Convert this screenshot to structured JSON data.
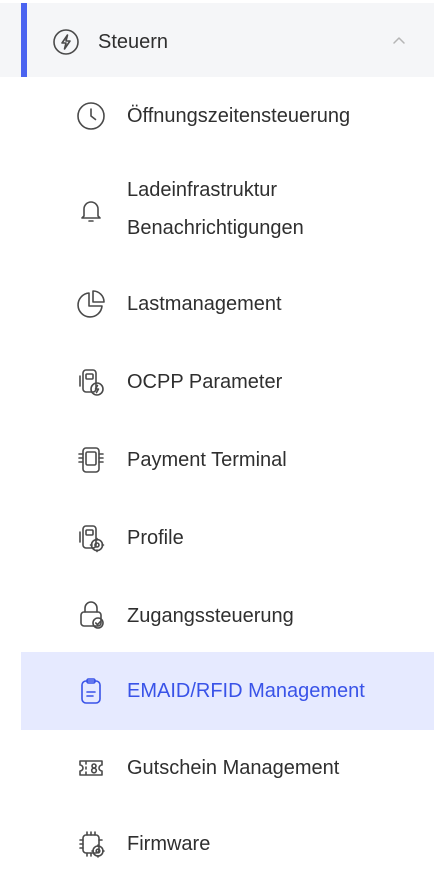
{
  "nav": {
    "group": {
      "label": "Steuern",
      "icon": "bolt-circle-icon",
      "state": "expanded"
    },
    "items": [
      {
        "label": "Öffnungszeitensteuerung",
        "icon": "clock-icon",
        "active": false
      },
      {
        "label_line1": "Ladeinfrastruktur",
        "label_line2": "Benachrichtigungen",
        "icon": "bell-icon",
        "active": false
      },
      {
        "label": "Lastmanagement",
        "icon": "pie-chart-icon",
        "active": false
      },
      {
        "label": "OCPP Parameter",
        "icon": "charger-bolt-icon",
        "active": false
      },
      {
        "label": "Payment Terminal",
        "icon": "payment-terminal-icon",
        "active": false
      },
      {
        "label": "Profile",
        "icon": "charger-gear-icon",
        "active": false
      },
      {
        "label": "Zugangssteuerung",
        "icon": "lock-check-icon",
        "active": false
      },
      {
        "label": "EMAID/RFID Management",
        "icon": "clipboard-icon",
        "active": true
      },
      {
        "label": "Gutschein Management",
        "icon": "voucher-icon",
        "active": false
      },
      {
        "label": "Firmware",
        "icon": "chip-gear-icon",
        "active": false
      }
    ],
    "colors": {
      "accent": "#4a63f0",
      "active_bg": "#e6eaff",
      "active_text": "#3953e8",
      "header_bg": "#f5f6f8"
    }
  }
}
